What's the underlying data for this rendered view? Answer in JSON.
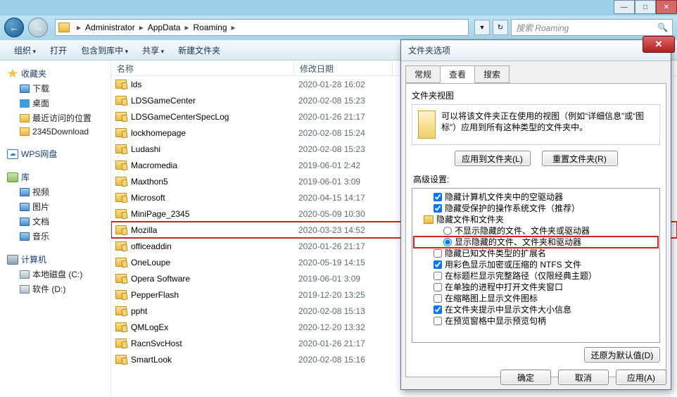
{
  "window_controls": {
    "min": "—",
    "max": "□",
    "close": "✕"
  },
  "nav": {
    "back": "←",
    "fwd": "→",
    "refresh": "↻",
    "dropdown": "▾"
  },
  "breadcrumb": {
    "root_icon": "folder",
    "items": [
      "Administrator",
      "AppData",
      "Roaming"
    ]
  },
  "search": {
    "placeholder": "搜索 Roaming",
    "icon": "🔍"
  },
  "toolbar": {
    "organize": "组织",
    "open": "打开",
    "include": "包含到库中",
    "share": "共享",
    "newfolder": "新建文件夹",
    "icons": {
      "view": "▤",
      "preview": "◧",
      "help": "?"
    }
  },
  "sidebar": {
    "favorites": {
      "label": "收藏夹",
      "items": [
        "下载",
        "桌面",
        "最近访问的位置",
        "2345Download"
      ]
    },
    "wps": {
      "label": "WPS网盘"
    },
    "libraries": {
      "label": "库",
      "items": [
        "视频",
        "图片",
        "文档",
        "音乐"
      ]
    },
    "computer": {
      "label": "计算机",
      "items": [
        "本地磁盘 (C:)",
        "软件 (D:)"
      ]
    }
  },
  "columns": {
    "name": "名称",
    "date": "修改日期"
  },
  "files": [
    {
      "name": "lds",
      "date": "2020-01-28 16:02"
    },
    {
      "name": "LDSGameCenter",
      "date": "2020-02-08 15:23"
    },
    {
      "name": "LDSGameCenterSpecLog",
      "date": "2020-01-26 21:17"
    },
    {
      "name": "lockhomepage",
      "date": "2020-02-08 15:24"
    },
    {
      "name": "Ludashi",
      "date": "2020-02-08 15:23"
    },
    {
      "name": "Macromedia",
      "date": "2019-06-01 2:42"
    },
    {
      "name": "Maxthon5",
      "date": "2019-06-01 3:09"
    },
    {
      "name": "Microsoft",
      "date": "2020-04-15 14:17"
    },
    {
      "name": "MiniPage_2345",
      "date": "2020-05-09 10:30"
    },
    {
      "name": "Mozilla",
      "date": "2020-03-23 14:52",
      "hl": true
    },
    {
      "name": "officeaddin",
      "date": "2020-01-26 21:17"
    },
    {
      "name": "OneLoupe",
      "date": "2020-05-19 14:15"
    },
    {
      "name": "Opera Software",
      "date": "2019-06-01 3:09"
    },
    {
      "name": "PepperFlash",
      "date": "2019-12-20 13:25"
    },
    {
      "name": "ppht",
      "date": "2020-02-08 15:13"
    },
    {
      "name": "QMLogEx",
      "date": "2020-12-20 13:32"
    },
    {
      "name": "RacnSvcHost",
      "date": "2020-01-26 21:17"
    },
    {
      "name": "SmartLook",
      "date": "2020-02-08 15:16"
    }
  ],
  "dialog": {
    "title": "文件夹选项",
    "close": "✕",
    "tabs": {
      "general": "常规",
      "view": "查看",
      "search": "搜索"
    },
    "folderview": {
      "heading": "文件夹视图",
      "desc1": "可以将该文件夹正在使用的视图（例如“详细信息”或“图标”）应用到所有这种类型的文件夹中。",
      "apply_btn": "应用到文件夹(L)",
      "reset_btn": "重置文件夹(R)"
    },
    "advanced_label": "高级设置:",
    "tree": [
      {
        "type": "check",
        "checked": true,
        "text": "隐藏计算机文件夹中的空驱动器"
      },
      {
        "type": "check",
        "checked": true,
        "text": "隐藏受保护的操作系统文件（推荐）"
      },
      {
        "type": "folder",
        "text": "隐藏文件和文件夹"
      },
      {
        "type": "radio",
        "checked": false,
        "lvl": 3,
        "text": "不显示隐藏的文件、文件夹或驱动器"
      },
      {
        "type": "radio",
        "checked": true,
        "lvl": 3,
        "hl": true,
        "text": "显示隐藏的文件、文件夹和驱动器"
      },
      {
        "type": "check",
        "checked": false,
        "text": "隐藏已知文件类型的扩展名"
      },
      {
        "type": "check",
        "checked": true,
        "text": "用彩色显示加密或压缩的 NTFS 文件"
      },
      {
        "type": "check",
        "checked": false,
        "text": "在标题栏显示完整路径（仅限经典主题）"
      },
      {
        "type": "check",
        "checked": false,
        "text": "在单独的进程中打开文件夹窗口"
      },
      {
        "type": "check",
        "checked": false,
        "text": "在缩略图上显示文件图标"
      },
      {
        "type": "check",
        "checked": true,
        "text": "在文件夹提示中显示文件大小信息"
      },
      {
        "type": "check",
        "checked": false,
        "text": "在预览窗格中显示预览句柄"
      }
    ],
    "restore_btn": "还原为默认值(D)",
    "ok": "确定",
    "cancel": "取消",
    "apply": "应用(A)"
  }
}
